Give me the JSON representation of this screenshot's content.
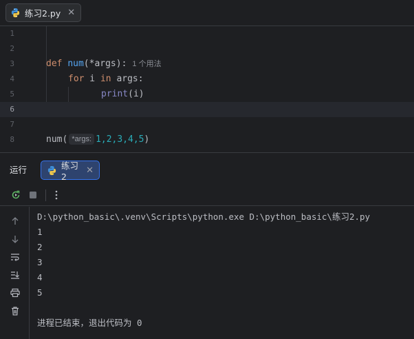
{
  "editor": {
    "tab": {
      "label": "练习2.py",
      "icon": "python-file-icon"
    },
    "current_line": 6,
    "lines": [
      {
        "number": "1"
      },
      {
        "number": "2"
      },
      {
        "number": "3",
        "def_kw": "def",
        "func": "num",
        "params": "(*args):",
        "usage_hint": "1 个用法"
      },
      {
        "number": "4",
        "for_kw": "for",
        "var": " i ",
        "in_kw": "in",
        "rest": " args:"
      },
      {
        "number": "5",
        "print_fn": "print",
        "print_args": "(i)"
      },
      {
        "number": "6"
      },
      {
        "number": "7"
      },
      {
        "number": "8",
        "call_fn": "num",
        "open_paren": "(",
        "param_hint": "*args:",
        "args": "1,2,3,4,5",
        "close_paren": ")"
      }
    ]
  },
  "run": {
    "title": "运行",
    "tab": {
      "label": "练习2"
    },
    "toolbar": {
      "rerun_icon": "rerun-icon",
      "stop_icon": "stop-icon",
      "more_icon": "more-vertical-icon"
    },
    "side_icons": [
      "arrow-up-icon",
      "arrow-down-icon",
      "soft-wrap-icon",
      "scroll-to-end-icon",
      "print-icon",
      "trash-icon"
    ],
    "console": {
      "command": "D:\\python_basic\\.venv\\Scripts\\python.exe D:\\python_basic\\练习2.py",
      "outputs": [
        "1",
        "2",
        "3",
        "4",
        "5"
      ],
      "exit_message": "进程已结束，退出代码为 0"
    }
  },
  "colors": {
    "background": "#1e1f22",
    "keyword": "#cf8e6d",
    "function": "#56a8f5",
    "number": "#2aacb8",
    "accent": "#3574f0"
  }
}
